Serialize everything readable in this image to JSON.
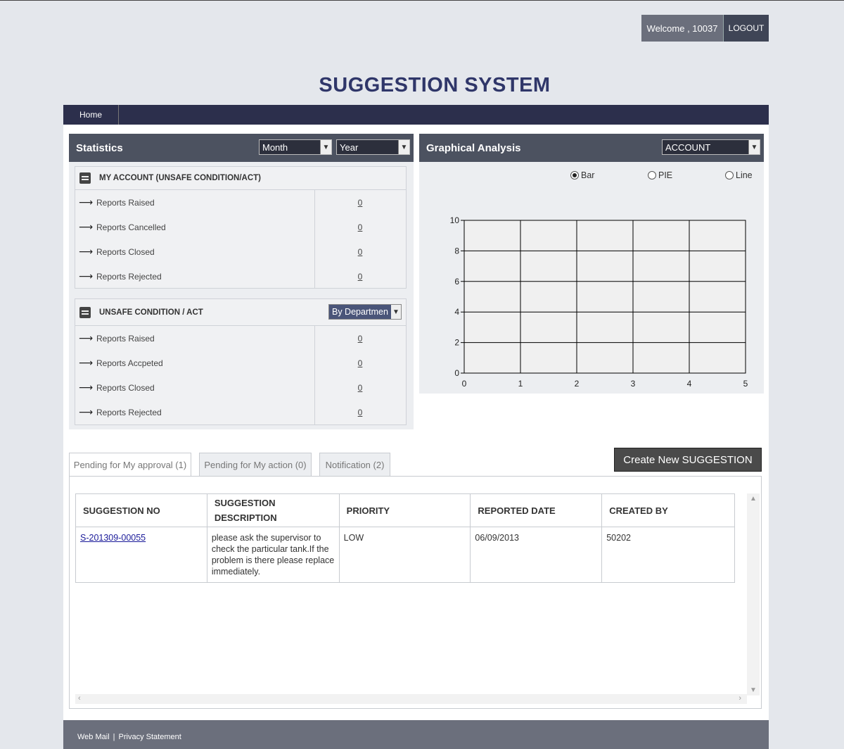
{
  "header": {
    "welcome": "Welcome , 10037",
    "logout": "LOGOUT",
    "title": "SUGGESTION SYSTEM"
  },
  "nav": {
    "home": "Home"
  },
  "statistics": {
    "title": "Statistics",
    "month_select": "Month",
    "year_select": "Year",
    "my_account": {
      "title": "MY ACCOUNT (UNSAFE CONDITION/ACT)",
      "rows": [
        {
          "label": "Reports Raised",
          "value": "0"
        },
        {
          "label": "Reports Cancelled",
          "value": "0"
        },
        {
          "label": "Reports Closed",
          "value": "0"
        },
        {
          "label": "Reports Rejected",
          "value": "0"
        }
      ]
    },
    "unsafe": {
      "title": "UNSAFE CONDITION / ACT",
      "filter": "By Departmen",
      "rows": [
        {
          "label": "Reports Raised",
          "value": "0"
        },
        {
          "label": "Reports Accpeted",
          "value": "0"
        },
        {
          "label": "Reports Closed",
          "value": "0"
        },
        {
          "label": "Reports Rejected",
          "value": "0"
        }
      ]
    }
  },
  "graph": {
    "title": "Graphical Analysis",
    "select": "ACCOUNT",
    "options": [
      "Bar",
      "PIE",
      "Line"
    ],
    "selected": "Bar"
  },
  "chart_data": {
    "type": "bar",
    "x_ticks": [
      "0",
      "1",
      "2",
      "3",
      "4",
      "5"
    ],
    "y_ticks": [
      "0",
      "2",
      "4",
      "6",
      "8",
      "10"
    ],
    "xlim": [
      0,
      5
    ],
    "ylim": [
      0,
      10
    ],
    "series": [],
    "grid": true
  },
  "tabs": {
    "pending_approval": "Pending for My approval (1)",
    "pending_action": "Pending for My action (0)",
    "notification": "Notification (2)",
    "create": "Create New SUGGESTION"
  },
  "table": {
    "headers": {
      "no": "SUGGESTION NO",
      "desc1": "SUGGESTION",
      "desc2": "DESCRIPTION",
      "priority": "PRIORITY",
      "date": "REPORTED DATE",
      "created": "CREATED BY"
    },
    "rows": [
      {
        "no": "S-201309-00055",
        "desc": "please ask the supervisor to check the particular tank.If the problem is there please replace immediately.",
        "priority": "LOW",
        "date": "06/09/2013",
        "created": "50202"
      }
    ]
  },
  "footer": {
    "webmail": "Web Mail",
    "sep": "|",
    "privacy": "Privacy Statement"
  }
}
